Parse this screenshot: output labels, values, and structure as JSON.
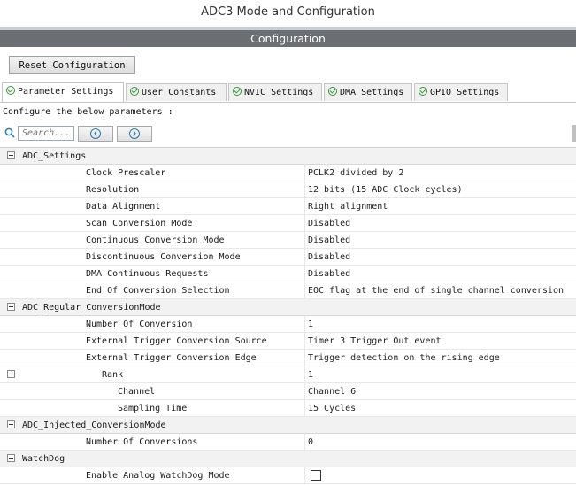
{
  "window_title": "ADC3 Mode and Configuration",
  "config_bar": "Configuration",
  "reset_button": "Reset Configuration",
  "tabs": [
    {
      "label": "Parameter Settings",
      "active": true
    },
    {
      "label": "User Constants",
      "active": false
    },
    {
      "label": "NVIC Settings",
      "active": false
    },
    {
      "label": "DMA Settings",
      "active": false
    },
    {
      "label": "GPIO Settings",
      "active": false
    }
  ],
  "configure_label": "Configure the below parameters :",
  "search": {
    "placeholder": "Search..."
  },
  "icons": {
    "search": "search-icon",
    "prev": "arrow-left-icon",
    "next": "arrow-right-icon",
    "collapse": "minus-box-icon",
    "check": "checkmark-icon"
  },
  "colors": {
    "config_bar": "#6b6e72",
    "check_green": "#3a9a3a",
    "nav_blue": "#2a7ab0"
  },
  "groups": [
    {
      "name": "ADC_Settings",
      "params": [
        {
          "name": "Clock Prescaler",
          "value": "PCLK2 divided by 2"
        },
        {
          "name": "Resolution",
          "value": "12 bits (15 ADC Clock cycles)"
        },
        {
          "name": "Data Alignment",
          "value": "Right alignment"
        },
        {
          "name": "Scan Conversion Mode",
          "value": "Disabled"
        },
        {
          "name": "Continuous Conversion Mode",
          "value": "Disabled"
        },
        {
          "name": "Discontinuous Conversion Mode",
          "value": "Disabled"
        },
        {
          "name": "DMA Continuous Requests",
          "value": "Disabled"
        },
        {
          "name": "End Of Conversion Selection",
          "value": "EOC flag at the end of single channel conversion"
        }
      ]
    },
    {
      "name": "ADC_Regular_ConversionMode",
      "params": [
        {
          "name": "Number Of Conversion",
          "value": "1"
        },
        {
          "name": "External Trigger Conversion Source",
          "value": "Timer 3 Trigger Out event"
        },
        {
          "name": "External Trigger Conversion Edge",
          "value": "Trigger detection on the rising edge"
        }
      ],
      "rank": {
        "name": "Rank",
        "value": "1",
        "params": [
          {
            "name": "Channel",
            "value": "Channel 6"
          },
          {
            "name": "Sampling Time",
            "value": "15 Cycles"
          }
        ]
      }
    },
    {
      "name": "ADC_Injected_ConversionMode",
      "params": [
        {
          "name": "Number Of Conversions",
          "value": "0"
        }
      ]
    },
    {
      "name": "WatchDog",
      "params": [
        {
          "name": "Enable Analog WatchDog Mode",
          "checked": false
        }
      ]
    }
  ]
}
